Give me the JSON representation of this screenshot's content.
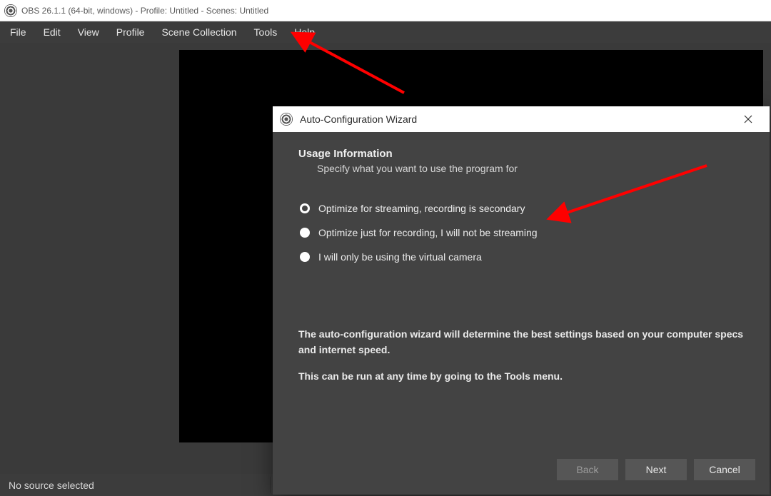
{
  "window": {
    "title": "OBS 26.1.1 (64-bit, windows) - Profile: Untitled - Scenes: Untitled"
  },
  "menubar": {
    "items": [
      "File",
      "Edit",
      "View",
      "Profile",
      "Scene Collection",
      "Tools",
      "Help"
    ]
  },
  "statusbar": {
    "text": "No source selected"
  },
  "dialog": {
    "title": "Auto-Configuration Wizard",
    "section_title": "Usage Information",
    "section_sub": "Specify what you want to use the program for",
    "options": [
      "Optimize for streaming, recording is secondary",
      "Optimize just for recording, I will not be streaming",
      "I will only be using the virtual camera"
    ],
    "selected_index": 0,
    "info1": "The auto-configuration wizard will determine the best settings based on your computer specs and internet speed.",
    "info2": "This can be run at any time by going to the Tools menu.",
    "back": "Back",
    "next": "Next",
    "cancel": "Cancel"
  }
}
